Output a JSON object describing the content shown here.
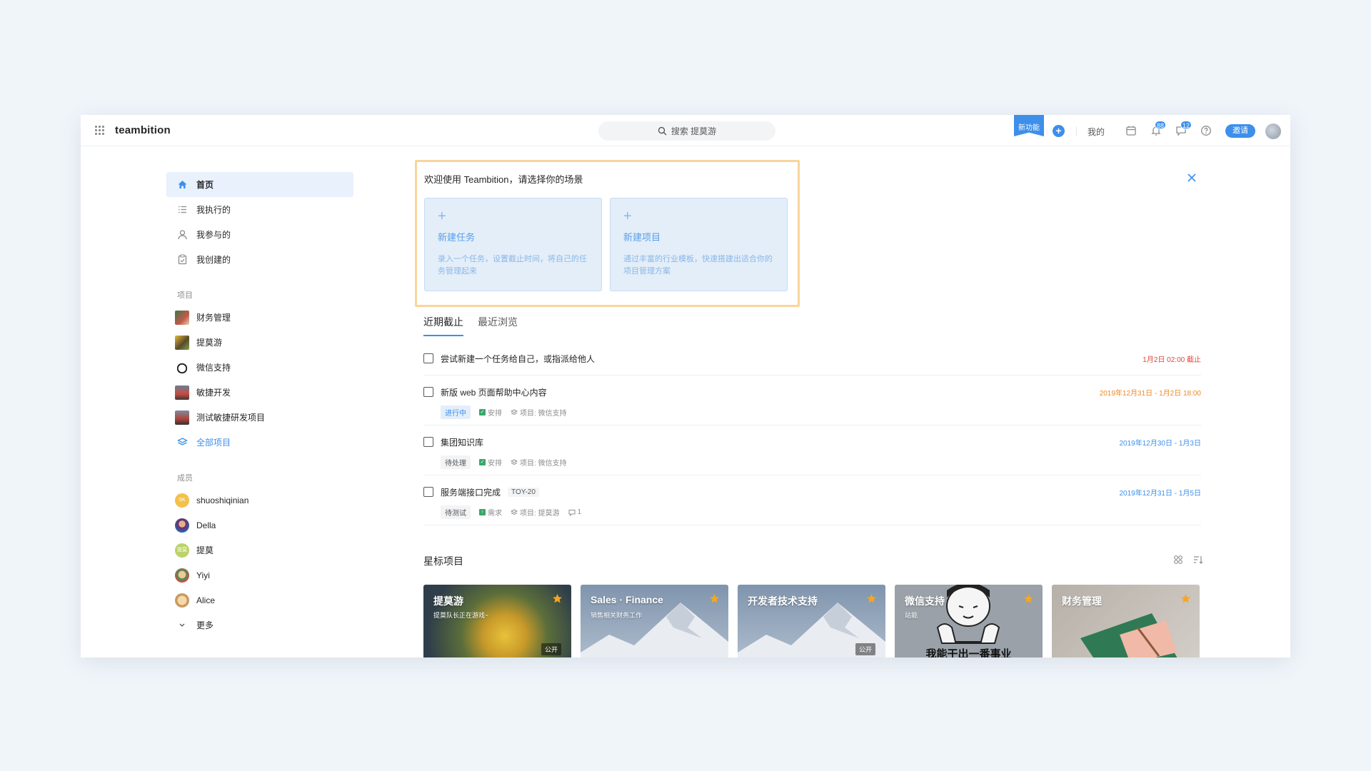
{
  "topbar": {
    "brand": "teambition",
    "search_placeholder": "搜索 提莫游",
    "new_feature": "新功能",
    "add": "+",
    "mine": "我的",
    "notification_count": "88",
    "message_count": "12",
    "invite": "邀请",
    "accent": "#3d8fea"
  },
  "sidebar": {
    "nav": [
      {
        "label": "首页",
        "icon": "home-icon"
      },
      {
        "label": "我执行的",
        "icon": "list-icon"
      },
      {
        "label": "我参与的",
        "icon": "person-icon"
      },
      {
        "label": "我创建的",
        "icon": "clipboard-icon"
      }
    ],
    "projects_label": "项目",
    "projects": [
      {
        "label": "财务管理"
      },
      {
        "label": "提莫游"
      },
      {
        "label": "微信支持"
      },
      {
        "label": "敏捷开发"
      },
      {
        "label": "测试敏捷研发项目"
      }
    ],
    "all_projects": "全部项目",
    "members_label": "成员",
    "members": [
      {
        "label": "shuoshiqinian",
        "initials": "SK"
      },
      {
        "label": "Della",
        "initials": ""
      },
      {
        "label": "提莫",
        "initials": "提莫"
      },
      {
        "label": "Yiyi",
        "initials": ""
      },
      {
        "label": "Alice",
        "initials": ""
      }
    ],
    "more": "更多"
  },
  "welcome": {
    "title": "欢迎使用 Teambition，请选择你的场景",
    "cards": [
      {
        "plus": "+",
        "title": "新建任务",
        "desc": "录入一个任务，设置截止时间，将自己的任务管理起来"
      },
      {
        "plus": "+",
        "title": "新建项目",
        "desc": "通过丰富的行业模板，快速搭建出适合你的项目管理方案"
      }
    ]
  },
  "tabs": [
    {
      "label": "近期截止"
    },
    {
      "label": "最近浏览"
    }
  ],
  "tasks": [
    {
      "title": "尝试新建一个任务给自己，或指派给他人",
      "date": "1月2日 02:00 截止",
      "date_color": "#e0463a"
    },
    {
      "title": "新版 web 页面帮助中心内容",
      "date": "2019年12月31日 - 1月2日 18:00",
      "date_color": "#f08a24",
      "status": "进行中",
      "type": "安排",
      "project": "项目: 微信支持"
    },
    {
      "title": "集团知识库",
      "date": "2019年12月30日 - 1月3日",
      "date_color": "#3d8fea",
      "status": "待处理",
      "type": "安排",
      "project": "项目: 微信支持"
    },
    {
      "title": "服务端接口完成",
      "code": "TOY-20",
      "date": "2019年12月31日 - 1月5日",
      "date_color": "#3d8fea",
      "status": "待测试",
      "type": "需求",
      "project": "项目: 提莫游",
      "comments": "1"
    }
  ],
  "starred": {
    "title": "星标项目",
    "projects": [
      {
        "title": "提莫游",
        "subtitle": "提莫队长正在游戏~",
        "badge": "公开"
      },
      {
        "title": "Sales · Finance",
        "subtitle": "销售相关财务工作",
        "badge": ""
      },
      {
        "title": "开发者技术支持",
        "subtitle": "",
        "badge": "公开"
      },
      {
        "title": "微信支持",
        "subtitle": "站能",
        "badge": "",
        "caption": "我能干出一番事业"
      },
      {
        "title": "财务管理",
        "subtitle": "",
        "badge": ""
      }
    ]
  }
}
